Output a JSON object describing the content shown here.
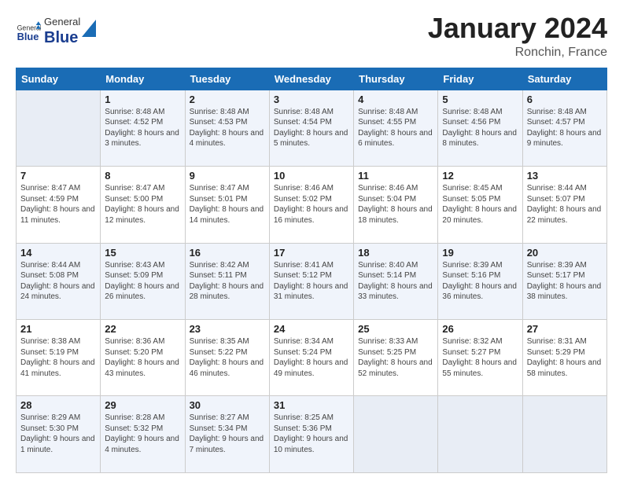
{
  "header": {
    "logo": {
      "general": "General",
      "blue": "Blue"
    },
    "title": "January 2024",
    "location": "Ronchin, France"
  },
  "days_of_week": [
    "Sunday",
    "Monday",
    "Tuesday",
    "Wednesday",
    "Thursday",
    "Friday",
    "Saturday"
  ],
  "weeks": [
    [
      {
        "day": "",
        "sunrise": "",
        "sunset": "",
        "daylight": ""
      },
      {
        "day": "1",
        "sunrise": "Sunrise: 8:48 AM",
        "sunset": "Sunset: 4:52 PM",
        "daylight": "Daylight: 8 hours and 3 minutes."
      },
      {
        "day": "2",
        "sunrise": "Sunrise: 8:48 AM",
        "sunset": "Sunset: 4:53 PM",
        "daylight": "Daylight: 8 hours and 4 minutes."
      },
      {
        "day": "3",
        "sunrise": "Sunrise: 8:48 AM",
        "sunset": "Sunset: 4:54 PM",
        "daylight": "Daylight: 8 hours and 5 minutes."
      },
      {
        "day": "4",
        "sunrise": "Sunrise: 8:48 AM",
        "sunset": "Sunset: 4:55 PM",
        "daylight": "Daylight: 8 hours and 6 minutes."
      },
      {
        "day": "5",
        "sunrise": "Sunrise: 8:48 AM",
        "sunset": "Sunset: 4:56 PM",
        "daylight": "Daylight: 8 hours and 8 minutes."
      },
      {
        "day": "6",
        "sunrise": "Sunrise: 8:48 AM",
        "sunset": "Sunset: 4:57 PM",
        "daylight": "Daylight: 8 hours and 9 minutes."
      }
    ],
    [
      {
        "day": "7",
        "sunrise": "Sunrise: 8:47 AM",
        "sunset": "Sunset: 4:59 PM",
        "daylight": "Daylight: 8 hours and 11 minutes."
      },
      {
        "day": "8",
        "sunrise": "Sunrise: 8:47 AM",
        "sunset": "Sunset: 5:00 PM",
        "daylight": "Daylight: 8 hours and 12 minutes."
      },
      {
        "day": "9",
        "sunrise": "Sunrise: 8:47 AM",
        "sunset": "Sunset: 5:01 PM",
        "daylight": "Daylight: 8 hours and 14 minutes."
      },
      {
        "day": "10",
        "sunrise": "Sunrise: 8:46 AM",
        "sunset": "Sunset: 5:02 PM",
        "daylight": "Daylight: 8 hours and 16 minutes."
      },
      {
        "day": "11",
        "sunrise": "Sunrise: 8:46 AM",
        "sunset": "Sunset: 5:04 PM",
        "daylight": "Daylight: 8 hours and 18 minutes."
      },
      {
        "day": "12",
        "sunrise": "Sunrise: 8:45 AM",
        "sunset": "Sunset: 5:05 PM",
        "daylight": "Daylight: 8 hours and 20 minutes."
      },
      {
        "day": "13",
        "sunrise": "Sunrise: 8:44 AM",
        "sunset": "Sunset: 5:07 PM",
        "daylight": "Daylight: 8 hours and 22 minutes."
      }
    ],
    [
      {
        "day": "14",
        "sunrise": "Sunrise: 8:44 AM",
        "sunset": "Sunset: 5:08 PM",
        "daylight": "Daylight: 8 hours and 24 minutes."
      },
      {
        "day": "15",
        "sunrise": "Sunrise: 8:43 AM",
        "sunset": "Sunset: 5:09 PM",
        "daylight": "Daylight: 8 hours and 26 minutes."
      },
      {
        "day": "16",
        "sunrise": "Sunrise: 8:42 AM",
        "sunset": "Sunset: 5:11 PM",
        "daylight": "Daylight: 8 hours and 28 minutes."
      },
      {
        "day": "17",
        "sunrise": "Sunrise: 8:41 AM",
        "sunset": "Sunset: 5:12 PM",
        "daylight": "Daylight: 8 hours and 31 minutes."
      },
      {
        "day": "18",
        "sunrise": "Sunrise: 8:40 AM",
        "sunset": "Sunset: 5:14 PM",
        "daylight": "Daylight: 8 hours and 33 minutes."
      },
      {
        "day": "19",
        "sunrise": "Sunrise: 8:39 AM",
        "sunset": "Sunset: 5:16 PM",
        "daylight": "Daylight: 8 hours and 36 minutes."
      },
      {
        "day": "20",
        "sunrise": "Sunrise: 8:39 AM",
        "sunset": "Sunset: 5:17 PM",
        "daylight": "Daylight: 8 hours and 38 minutes."
      }
    ],
    [
      {
        "day": "21",
        "sunrise": "Sunrise: 8:38 AM",
        "sunset": "Sunset: 5:19 PM",
        "daylight": "Daylight: 8 hours and 41 minutes."
      },
      {
        "day": "22",
        "sunrise": "Sunrise: 8:36 AM",
        "sunset": "Sunset: 5:20 PM",
        "daylight": "Daylight: 8 hours and 43 minutes."
      },
      {
        "day": "23",
        "sunrise": "Sunrise: 8:35 AM",
        "sunset": "Sunset: 5:22 PM",
        "daylight": "Daylight: 8 hours and 46 minutes."
      },
      {
        "day": "24",
        "sunrise": "Sunrise: 8:34 AM",
        "sunset": "Sunset: 5:24 PM",
        "daylight": "Daylight: 8 hours and 49 minutes."
      },
      {
        "day": "25",
        "sunrise": "Sunrise: 8:33 AM",
        "sunset": "Sunset: 5:25 PM",
        "daylight": "Daylight: 8 hours and 52 minutes."
      },
      {
        "day": "26",
        "sunrise": "Sunrise: 8:32 AM",
        "sunset": "Sunset: 5:27 PM",
        "daylight": "Daylight: 8 hours and 55 minutes."
      },
      {
        "day": "27",
        "sunrise": "Sunrise: 8:31 AM",
        "sunset": "Sunset: 5:29 PM",
        "daylight": "Daylight: 8 hours and 58 minutes."
      }
    ],
    [
      {
        "day": "28",
        "sunrise": "Sunrise: 8:29 AM",
        "sunset": "Sunset: 5:30 PM",
        "daylight": "Daylight: 9 hours and 1 minute."
      },
      {
        "day": "29",
        "sunrise": "Sunrise: 8:28 AM",
        "sunset": "Sunset: 5:32 PM",
        "daylight": "Daylight: 9 hours and 4 minutes."
      },
      {
        "day": "30",
        "sunrise": "Sunrise: 8:27 AM",
        "sunset": "Sunset: 5:34 PM",
        "daylight": "Daylight: 9 hours and 7 minutes."
      },
      {
        "day": "31",
        "sunrise": "Sunrise: 8:25 AM",
        "sunset": "Sunset: 5:36 PM",
        "daylight": "Daylight: 9 hours and 10 minutes."
      },
      {
        "day": "",
        "sunrise": "",
        "sunset": "",
        "daylight": ""
      },
      {
        "day": "",
        "sunrise": "",
        "sunset": "",
        "daylight": ""
      },
      {
        "day": "",
        "sunrise": "",
        "sunset": "",
        "daylight": ""
      }
    ]
  ]
}
